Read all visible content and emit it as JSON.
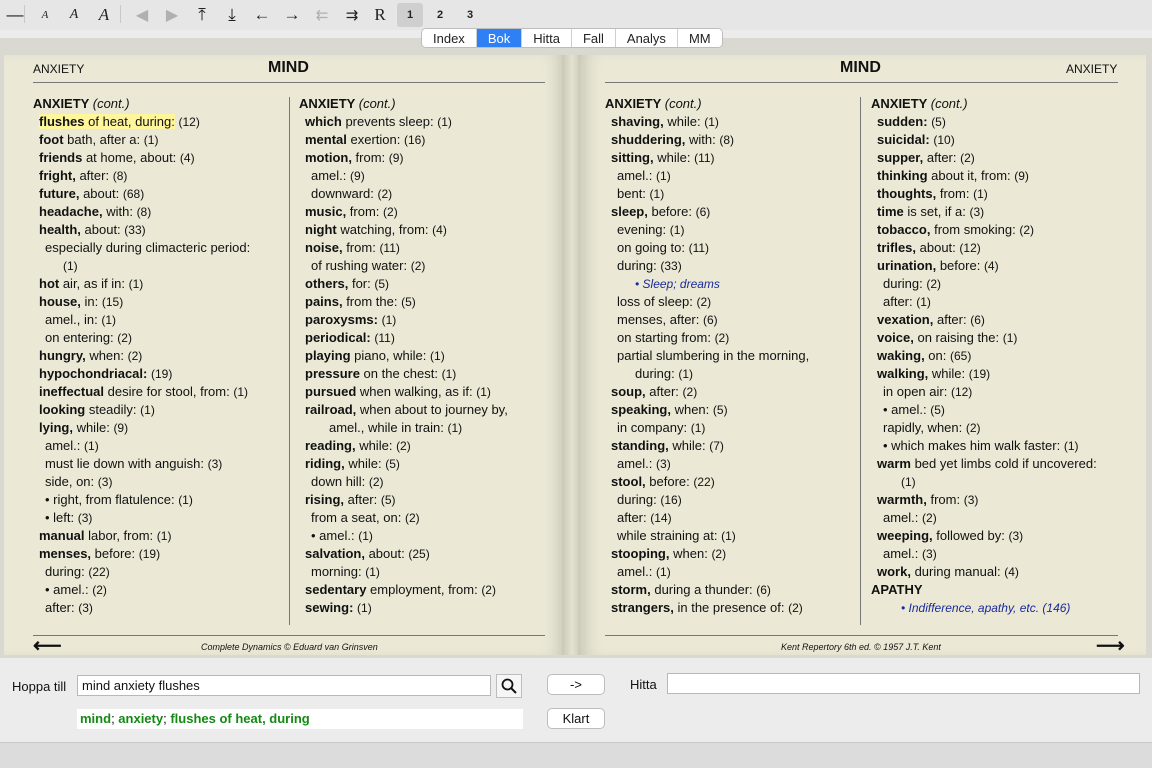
{
  "toolbar": {
    "buttons": [
      "—",
      "A",
      "A",
      "A",
      "◀",
      "▶",
      "⤒",
      "⤓",
      "←",
      "→",
      "⇇",
      "⇉",
      "R"
    ],
    "pages": [
      "1",
      "2",
      "3"
    ]
  },
  "tabs": [
    "Index",
    "Bok",
    "Hitta",
    "Fall",
    "Analys",
    "MM"
  ],
  "left_page": {
    "header_small": "ANXIETY",
    "header_big": "MIND",
    "footer": "Complete Dynamics © Eduard van Grinsven"
  },
  "right_page": {
    "header_small": "ANXIETY",
    "header_big": "MIND",
    "footer": "Kent Repertory 6th ed. © 1957 J.T. Kent"
  },
  "columns": [
    {
      "heading": "ANXIETY",
      "heading_note": "(cont.)",
      "lines": [
        {
          "b": "flushes",
          "t": " of heat, during:",
          "n": "(12)",
          "ind": 1,
          "hl": true
        },
        {
          "b": "foot",
          "t": " bath, after a:",
          "n": "(1)",
          "ind": 1
        },
        {
          "b": "friends",
          "t": " at home, about:",
          "n": "(4)",
          "ind": 1
        },
        {
          "b": "fright,",
          "t": " after:",
          "n": "(8)",
          "ind": 1
        },
        {
          "b": "future,",
          "t": " about:",
          "n": "(68)",
          "ind": 1
        },
        {
          "b": "headache,",
          "t": " with:",
          "n": "(8)",
          "ind": 1
        },
        {
          "b": "health,",
          "t": " about:",
          "n": "(33)",
          "ind": 1
        },
        {
          "b": "",
          "t": "especially during climacteric period:",
          "n": "",
          "ind": 2
        },
        {
          "b": "",
          "t": "",
          "n": "(1)",
          "ind": 3
        },
        {
          "b": "hot",
          "t": " air, as if in:",
          "n": "(1)",
          "ind": 1
        },
        {
          "b": "house,",
          "t": " in:",
          "n": "(15)",
          "ind": 1
        },
        {
          "b": "",
          "t": "amel., in:",
          "n": "(1)",
          "ind": 2
        },
        {
          "b": "",
          "t": "on entering:",
          "n": "(2)",
          "ind": 2
        },
        {
          "b": "hungry,",
          "t": " when:",
          "n": "(2)",
          "ind": 1
        },
        {
          "b": "hypochondriacal:",
          "t": "",
          "n": "(19)",
          "ind": 1
        },
        {
          "b": "ineffectual",
          "t": " desire for stool, from:",
          "n": "(1)",
          "ind": 1
        },
        {
          "b": "looking",
          "t": " steadily:",
          "n": "(1)",
          "ind": 1
        },
        {
          "b": "lying,",
          "t": " while:",
          "n": "(9)",
          "ind": 1
        },
        {
          "b": "",
          "t": "amel.:",
          "n": "(1)",
          "ind": 2
        },
        {
          "b": "",
          "t": "must lie down with anguish:",
          "n": "(3)",
          "ind": 2
        },
        {
          "b": "",
          "t": "side, on:",
          "n": "(3)",
          "ind": 2
        },
        {
          "b": "",
          "t": "• right, from flatulence:",
          "n": "(1)",
          "ind": 2
        },
        {
          "b": "",
          "t": "• left:",
          "n": "(3)",
          "ind": 2
        },
        {
          "b": "manual",
          "t": " labor, from:",
          "n": "(1)",
          "ind": 1
        },
        {
          "b": "menses,",
          "t": " before:",
          "n": "(19)",
          "ind": 1
        },
        {
          "b": "",
          "t": "during:",
          "n": "(22)",
          "ind": 2
        },
        {
          "b": "",
          "t": "• amel.:",
          "n": "(2)",
          "ind": 2
        },
        {
          "b": "",
          "t": "after:",
          "n": "(3)",
          "ind": 2
        }
      ]
    },
    {
      "heading": "ANXIETY",
      "heading_note": "(cont.)",
      "lines": [
        {
          "b": "which",
          "t": " prevents sleep:",
          "n": "(1)",
          "ind": 1
        },
        {
          "b": "mental",
          "t": " exertion:",
          "n": "(16)",
          "ind": 1
        },
        {
          "b": "motion,",
          "t": " from:",
          "n": "(9)",
          "ind": 1
        },
        {
          "b": "",
          "t": "amel.:",
          "n": "(9)",
          "ind": 2
        },
        {
          "b": "",
          "t": "downward:",
          "n": "(2)",
          "ind": 2
        },
        {
          "b": "music,",
          "t": " from:",
          "n": "(2)",
          "ind": 1
        },
        {
          "b": "night",
          "t": " watching, from:",
          "n": "(4)",
          "ind": 1
        },
        {
          "b": "noise,",
          "t": " from:",
          "n": "(11)",
          "ind": 1
        },
        {
          "b": "",
          "t": "of rushing water:",
          "n": "(2)",
          "ind": 2
        },
        {
          "b": "others,",
          "t": " for:",
          "n": "(5)",
          "ind": 1
        },
        {
          "b": "pains,",
          "t": " from the:",
          "n": "(5)",
          "ind": 1
        },
        {
          "b": "paroxysms:",
          "t": "",
          "n": "(1)",
          "ind": 1
        },
        {
          "b": "periodical:",
          "t": "",
          "n": "(11)",
          "ind": 1
        },
        {
          "b": "playing",
          "t": " piano, while:",
          "n": "(1)",
          "ind": 1
        },
        {
          "b": "pressure",
          "t": " on the chest:",
          "n": "(1)",
          "ind": 1
        },
        {
          "b": "pursued",
          "t": " when walking, as if:",
          "n": "(1)",
          "ind": 1
        },
        {
          "b": "railroad,",
          "t": " when about to journey by,",
          "n": "",
          "ind": 1
        },
        {
          "b": "",
          "t": "amel., while in train:",
          "n": "(1)",
          "ind": 3
        },
        {
          "b": "reading,",
          "t": " while:",
          "n": "(2)",
          "ind": 1
        },
        {
          "b": "riding,",
          "t": " while:",
          "n": "(5)",
          "ind": 1
        },
        {
          "b": "",
          "t": "down hill:",
          "n": "(2)",
          "ind": 2
        },
        {
          "b": "rising,",
          "t": " after:",
          "n": "(5)",
          "ind": 1
        },
        {
          "b": "",
          "t": "from a seat, on:",
          "n": "(2)",
          "ind": 2
        },
        {
          "b": "",
          "t": "• amel.:",
          "n": "(1)",
          "ind": 2
        },
        {
          "b": "salvation,",
          "t": " about:",
          "n": "(25)",
          "ind": 1
        },
        {
          "b": "",
          "t": "morning:",
          "n": "(1)",
          "ind": 2
        },
        {
          "b": "sedentary",
          "t": " employment, from:",
          "n": "(2)",
          "ind": 1
        },
        {
          "b": "sewing:",
          "t": "",
          "n": "(1)",
          "ind": 1
        }
      ]
    },
    {
      "heading": "ANXIETY",
      "heading_note": "(cont.)",
      "lines": [
        {
          "b": "shaving,",
          "t": " while:",
          "n": "(1)",
          "ind": 1
        },
        {
          "b": "shuddering,",
          "t": " with:",
          "n": "(8)",
          "ind": 1
        },
        {
          "b": "sitting,",
          "t": " while:",
          "n": "(11)",
          "ind": 1
        },
        {
          "b": "",
          "t": "amel.:",
          "n": "(1)",
          "ind": 2
        },
        {
          "b": "",
          "t": "bent:",
          "n": "(1)",
          "ind": 2
        },
        {
          "b": "sleep,",
          "t": " before:",
          "n": "(6)",
          "ind": 1
        },
        {
          "b": "",
          "t": "evening:",
          "n": "(1)",
          "ind": 2
        },
        {
          "b": "",
          "t": "on going to:",
          "n": "(11)",
          "ind": 2
        },
        {
          "b": "",
          "t": "during:",
          "n": "(33)",
          "ind": 2
        },
        {
          "ref": "• Sleep; dreams"
        },
        {
          "b": "",
          "t": "loss of sleep:",
          "n": "(2)",
          "ind": 2
        },
        {
          "b": "",
          "t": "menses, after:",
          "n": "(6)",
          "ind": 2
        },
        {
          "b": "",
          "t": "on starting from:",
          "n": "(2)",
          "ind": 2
        },
        {
          "b": "",
          "t": "partial slumbering in the morning,",
          "n": "",
          "ind": 2
        },
        {
          "b": "",
          "t": "during:",
          "n": "(1)",
          "ind": 3
        },
        {
          "b": "soup,",
          "t": " after:",
          "n": "(2)",
          "ind": 1
        },
        {
          "b": "speaking,",
          "t": " when:",
          "n": "(5)",
          "ind": 1
        },
        {
          "b": "",
          "t": "in company:",
          "n": "(1)",
          "ind": 2
        },
        {
          "b": "standing,",
          "t": " while:",
          "n": "(7)",
          "ind": 1
        },
        {
          "b": "",
          "t": "amel.:",
          "n": "(3)",
          "ind": 2
        },
        {
          "b": "stool,",
          "t": " before:",
          "n": "(22)",
          "ind": 1
        },
        {
          "b": "",
          "t": "during:",
          "n": "(16)",
          "ind": 2
        },
        {
          "b": "",
          "t": "after:",
          "n": "(14)",
          "ind": 2
        },
        {
          "b": "",
          "t": "while straining at:",
          "n": "(1)",
          "ind": 2
        },
        {
          "b": "stooping,",
          "t": " when:",
          "n": "(2)",
          "ind": 1
        },
        {
          "b": "",
          "t": "amel.:",
          "n": "(1)",
          "ind": 2
        },
        {
          "b": "storm,",
          "t": " during a thunder:",
          "n": "(6)",
          "ind": 1
        },
        {
          "b": "strangers,",
          "t": " in the presence of:",
          "n": "(2)",
          "ind": 1
        }
      ]
    },
    {
      "heading": "ANXIETY",
      "heading_note": "(cont.)",
      "lines": [
        {
          "b": "sudden:",
          "t": "",
          "n": "(5)",
          "ind": 1
        },
        {
          "b": "suicidal:",
          "t": "",
          "n": "(10)",
          "ind": 1
        },
        {
          "b": "supper,",
          "t": " after:",
          "n": "(2)",
          "ind": 1
        },
        {
          "b": "thinking",
          "t": " about it, from:",
          "n": "(9)",
          "ind": 1
        },
        {
          "b": "thoughts,",
          "t": " from:",
          "n": "(1)",
          "ind": 1
        },
        {
          "b": "time",
          "t": " is set, if a:",
          "n": "(3)",
          "ind": 1
        },
        {
          "b": "tobacco,",
          "t": " from smoking:",
          "n": "(2)",
          "ind": 1
        },
        {
          "b": "trifles,",
          "t": " about:",
          "n": "(12)",
          "ind": 1
        },
        {
          "b": "urination,",
          "t": " before:",
          "n": "(4)",
          "ind": 1
        },
        {
          "b": "",
          "t": "during:",
          "n": "(2)",
          "ind": 2
        },
        {
          "b": "",
          "t": "after:",
          "n": "(1)",
          "ind": 2
        },
        {
          "b": "vexation,",
          "t": " after:",
          "n": "(6)",
          "ind": 1
        },
        {
          "b": "voice,",
          "t": " on raising the:",
          "n": "(1)",
          "ind": 1
        },
        {
          "b": "waking,",
          "t": " on:",
          "n": "(65)",
          "ind": 1
        },
        {
          "b": "walking,",
          "t": " while:",
          "n": "(19)",
          "ind": 1
        },
        {
          "b": "",
          "t": "in open air:",
          "n": "(12)",
          "ind": 2
        },
        {
          "b": "",
          "t": "• amel.:",
          "n": "(5)",
          "ind": 2
        },
        {
          "b": "",
          "t": "rapidly, when:",
          "n": "(2)",
          "ind": 2
        },
        {
          "b": "",
          "t": "• which makes him walk faster:",
          "n": "(1)",
          "ind": 2
        },
        {
          "b": "warm",
          "t": " bed yet limbs cold if uncovered:",
          "n": "",
          "ind": 1
        },
        {
          "b": "",
          "t": "",
          "n": "(1)",
          "ind": 3
        },
        {
          "b": "warmth,",
          "t": " from:",
          "n": "(3)",
          "ind": 1
        },
        {
          "b": "",
          "t": "amel.:",
          "n": "(2)",
          "ind": 2
        },
        {
          "b": "weeping,",
          "t": " followed by:",
          "n": "(3)",
          "ind": 1
        },
        {
          "b": "",
          "t": "amel.:",
          "n": "(3)",
          "ind": 2
        },
        {
          "b": "work,",
          "t": " during manual:",
          "n": "(4)",
          "ind": 1
        },
        {
          "heading": "APATHY"
        },
        {
          "ref": "• Indifference, apathy, etc. (146)"
        }
      ]
    }
  ],
  "bottom": {
    "jump_label": "Hoppa till",
    "jump_value": "mind anxiety flushes",
    "go_button": "->",
    "search_label": "Hitta",
    "search_value": "",
    "clear_button": "Klart",
    "path": [
      "mind",
      "anxiety",
      "flushes of heat, during"
    ]
  }
}
